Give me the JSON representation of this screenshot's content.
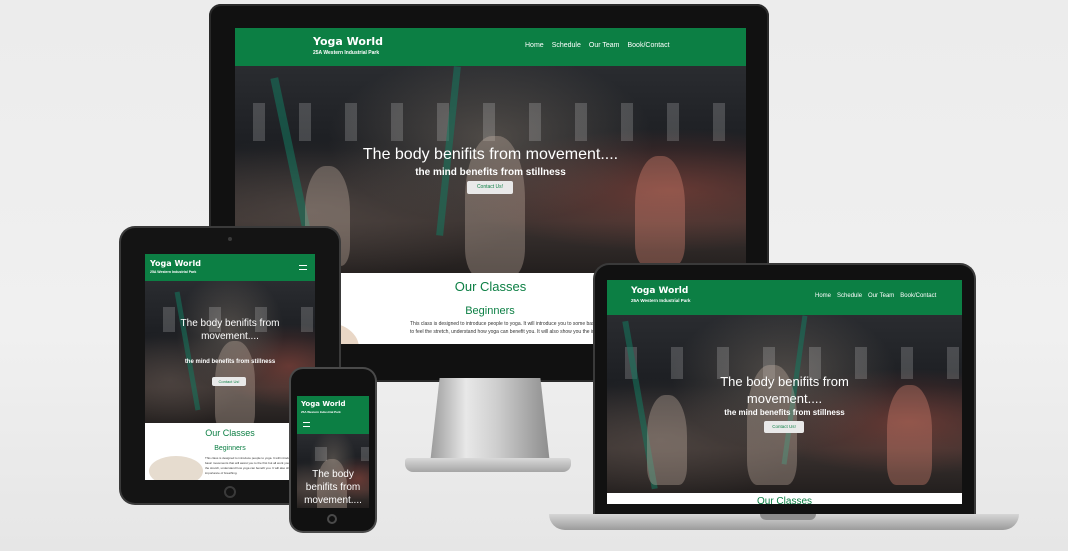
{
  "site": {
    "brand": "Yoga World",
    "address": "25A Western Industrial Park",
    "nav": [
      "Home",
      "Schedule",
      "Our Team",
      "Book/Contact"
    ],
    "hero_title": "The body benifits from movement....",
    "hero_sub": "the mind benefits from stillness",
    "cta": "Contact Us!",
    "classes_title": "Our Classes",
    "class_name": "Beginners",
    "class_text": "This class is designed to introduce people to yoga. It will introduce you to some basic movements that will assist you to the first but all work you enough to feel the stretch, understand how yoga can benefit you. It will also show you the importance of breathing.",
    "menu_icon": "hamburger-menu-icon"
  },
  "colors": {
    "brand_green": "#0c7f44",
    "hero_dark": "#1c1e22",
    "button_bg": "#e9e9e9"
  },
  "devices": [
    "desktop-monitor",
    "tablet",
    "laptop",
    "smartphone"
  ]
}
